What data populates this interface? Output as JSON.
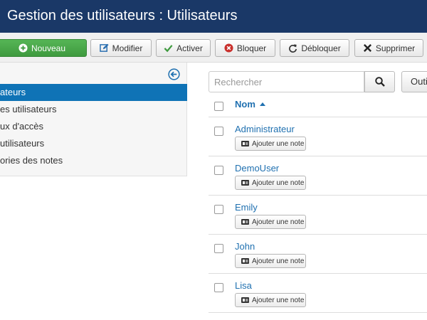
{
  "header": {
    "title": "Gestion des utilisateurs : Utilisateurs"
  },
  "toolbar": {
    "new_label": "Nouveau",
    "edit_label": "Modifier",
    "activate_label": "Activer",
    "block_label": "Bloquer",
    "unblock_label": "Débloquer",
    "delete_label": "Supprimer"
  },
  "sidebar": {
    "items": [
      {
        "label": "ateurs"
      },
      {
        "label": "es utilisateurs"
      },
      {
        "label": "ux d'accès"
      },
      {
        "label": "utilisateurs"
      },
      {
        "label": "ories des notes"
      }
    ]
  },
  "search": {
    "placeholder": "Rechercher",
    "tools_label": "Outi"
  },
  "table": {
    "column_name": "Nom",
    "note_label": "Ajouter une note",
    "rows": [
      {
        "name": "Administrateur"
      },
      {
        "name": "DemoUser"
      },
      {
        "name": "Emily"
      },
      {
        "name": "John"
      },
      {
        "name": "Lisa"
      }
    ]
  },
  "colors": {
    "header_bg": "#1a3867",
    "new_button": "#4aab4a",
    "active_item": "#0f73b6",
    "link": "#1f70b0"
  }
}
